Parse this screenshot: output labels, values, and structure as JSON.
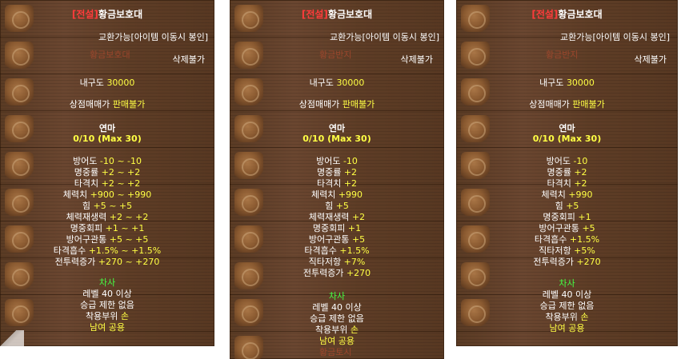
{
  "panels": [
    {
      "title_prefix": "[전설]",
      "title_name": "황금보호대",
      "tradable": "교환가능[아이템 이동시 봉인]",
      "bg_item_name": "황금보호대",
      "delete": "삭제불가",
      "durability_label": "내구도",
      "durability_value": "30000",
      "shop_label": "상점매매가",
      "shop_value": "판매불가",
      "enhance_label": "연마",
      "enhance_value": "0/10 (Max 30)",
      "stats": [
        {
          "label": "방어도",
          "value": "-10 ~ -10"
        },
        {
          "label": "명중률",
          "value": "+2 ~ +2"
        },
        {
          "label": "타격치",
          "value": "+2 ~ +2"
        },
        {
          "label": "체력치",
          "value": "+900 ~ +990"
        },
        {
          "label": "힘",
          "value": "+5 ~ +5"
        },
        {
          "label": "체력재생력",
          "value": "+2 ~ +2"
        },
        {
          "label": "명중회피",
          "value": "+1 ~ +1"
        },
        {
          "label": "방어구관통",
          "value": "+5 ~ +5"
        },
        {
          "label": "타격흡수",
          "value": "+1.5% ~ +1.5%"
        },
        {
          "label": "전투력증가",
          "value": "+270 ~ +270"
        }
      ],
      "class": "차사",
      "level_req": "레벨 40 이상",
      "rank_req": "승급 제한 없음",
      "slot_label": "착용부위",
      "slot_value": "손",
      "gender": "남여 공용"
    },
    {
      "title_prefix": "[전설]",
      "title_name": "황금보호대",
      "tradable": "교환가능[아이템 이동시 봉인]",
      "bg_item_name": "황금반지",
      "delete": "삭제불가",
      "durability_label": "내구도",
      "durability_value": "30000",
      "shop_label": "상점매매가",
      "shop_value": "판매불가",
      "enhance_label": "연마",
      "enhance_value": "0/10 (Max 30)",
      "stats": [
        {
          "label": "방어도",
          "value": "-10"
        },
        {
          "label": "명중률",
          "value": "+2"
        },
        {
          "label": "타격치",
          "value": "+2"
        },
        {
          "label": "체력치",
          "value": "+990"
        },
        {
          "label": "힘",
          "value": "+5"
        },
        {
          "label": "체력재생력",
          "value": "+2"
        },
        {
          "label": "명중회피",
          "value": "+1"
        },
        {
          "label": "방어구관통",
          "value": "+5"
        },
        {
          "label": "타격흡수",
          "value": "+1.5%"
        },
        {
          "label": "직타저항",
          "value": "+7%"
        },
        {
          "label": "전투력증가",
          "value": "+270"
        }
      ],
      "class": "차사",
      "level_req": "레벨 40 이상",
      "rank_req": "승급 제한 없음",
      "slot_label": "착용부위",
      "slot_value": "손",
      "gender": "남여 공용",
      "bg_bottom_name": "황금토시"
    },
    {
      "title_prefix": "[전설]",
      "title_name": "황금보호대",
      "tradable": "교환가능[아이템 이동시 봉인]",
      "bg_item_name": "황금반지",
      "delete": "삭제불가",
      "durability_label": "내구도",
      "durability_value": "30000",
      "shop_label": "상점매매가",
      "shop_value": "판매불가",
      "enhance_label": "연마",
      "enhance_value": "0/10 (Max 30)",
      "stats": [
        {
          "label": "방어도",
          "value": "-10"
        },
        {
          "label": "명중률",
          "value": "+2"
        },
        {
          "label": "타격치",
          "value": "+2"
        },
        {
          "label": "체력치",
          "value": "+990"
        },
        {
          "label": "힘",
          "value": "+5"
        },
        {
          "label": "명중회피",
          "value": "+1"
        },
        {
          "label": "방어구관통",
          "value": "+5"
        },
        {
          "label": "타격흡수",
          "value": "+1.5%"
        },
        {
          "label": "직타저항",
          "value": "+5%"
        },
        {
          "label": "전투력증가",
          "value": "+270"
        }
      ],
      "class": "차사",
      "level_req": "레벨 40 이상",
      "rank_req": "승급 제한 없음",
      "slot_label": "착용부위",
      "slot_value": "손",
      "gender": "남여 공용"
    }
  ],
  "colors": {
    "legend": "#ff3b3b",
    "white": "#ffffff",
    "yellow": "#ffff44",
    "green": "#44ff44",
    "panel_bg": "#5b3a22"
  }
}
